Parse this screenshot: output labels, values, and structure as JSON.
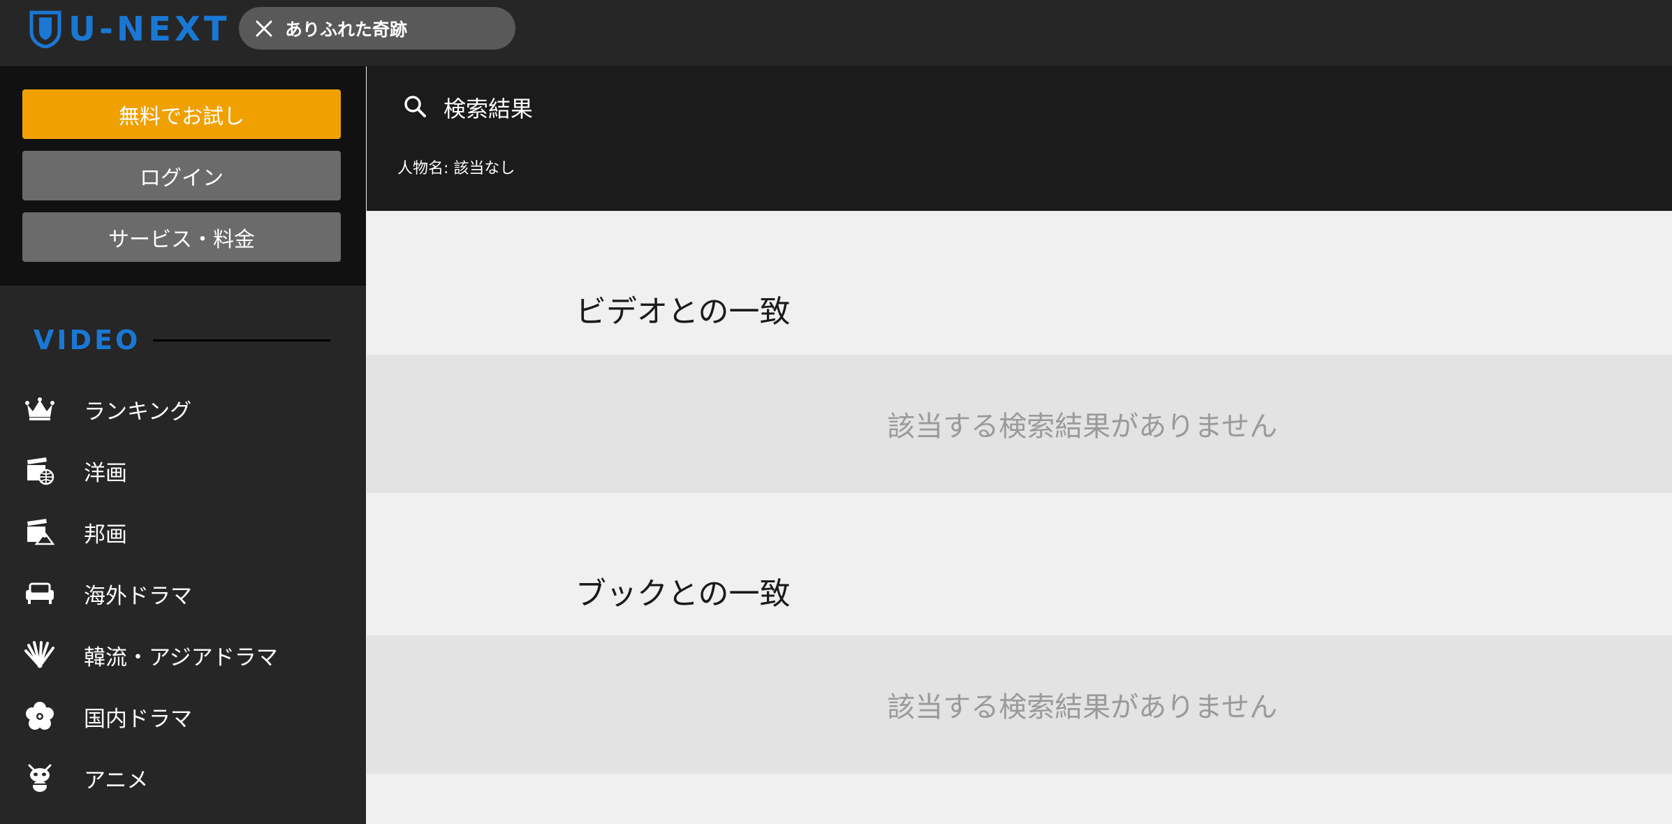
{
  "header": {
    "logo_text": "U-NEXT",
    "search_chip_text": "ありふれた奇跡",
    "brand_color": "#1a78d4"
  },
  "sidebar": {
    "buttons": {
      "trial": "無料でお試し",
      "login": "ログイン",
      "service": "サービス・料金"
    },
    "section_title": "VIDEO",
    "items": [
      {
        "label": "ランキング",
        "icon": "crown-icon"
      },
      {
        "label": "洋画",
        "icon": "clapperboard-globe-icon"
      },
      {
        "label": "邦画",
        "icon": "clapperboard-mountain-icon"
      },
      {
        "label": "海外ドラマ",
        "icon": "sofa-icon"
      },
      {
        "label": "韓流・アジアドラマ",
        "icon": "folding-fan-icon"
      },
      {
        "label": "国内ドラマ",
        "icon": "plum-blossom-icon"
      },
      {
        "label": "アニメ",
        "icon": "anime-character-icon"
      }
    ]
  },
  "results": {
    "title": "検索結果",
    "person_line": "人物名: 該当なし",
    "sections": [
      {
        "title": "ビデオとの一致",
        "empty_message": "該当する検索結果がありません"
      },
      {
        "title": "ブックとの一致",
        "empty_message": "該当する検索結果がありません"
      }
    ]
  },
  "colors": {
    "accent_orange": "#f0a000",
    "button_gray": "#6b6b6b",
    "sidebar_bg": "#262626"
  }
}
